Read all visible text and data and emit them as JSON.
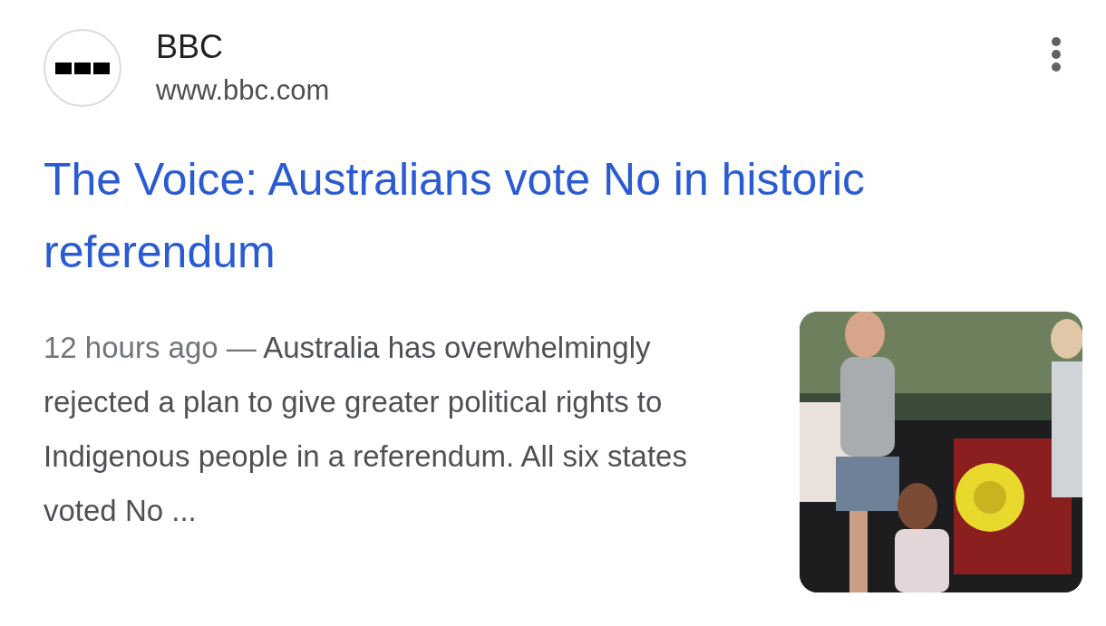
{
  "source": {
    "name": "BBC",
    "url": "www.bbc.com"
  },
  "title": "The Voice: Australians vote No in historic referendum",
  "snippet": {
    "date": "12 hours ago",
    "separator": "—",
    "text": "Australia has overwhelmingly rejected a plan to give greater political rights to Indigenous people in a referendum. All six states voted No ..."
  }
}
